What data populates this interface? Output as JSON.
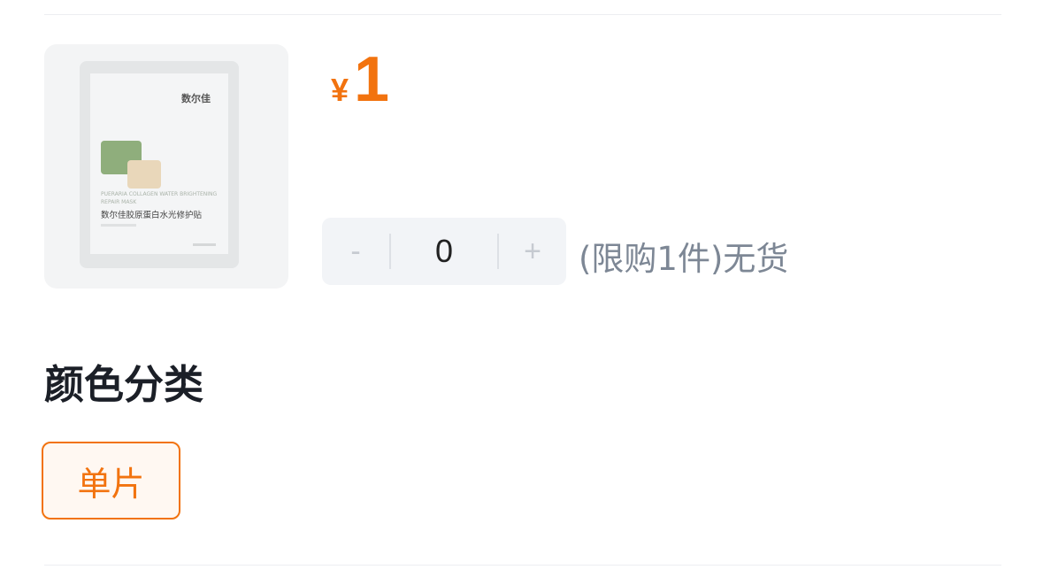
{
  "product": {
    "image": {
      "brand": "数尔佳",
      "latin_name": "PUERARIA COLLAGEN WATER BRIGHTENING REPAIR MASK",
      "cn_name": "数尔佳胶原蛋白水光修护贴"
    },
    "price": {
      "currency": "¥",
      "amount": "1"
    }
  },
  "quantity": {
    "decrement_label": "-",
    "value": "0",
    "increment_label": "+",
    "limit_text": "(限购1件)无货"
  },
  "variant": {
    "section_title": "颜色分类",
    "options": [
      {
        "label": "单片",
        "selected": true
      }
    ]
  },
  "colors": {
    "accent": "#f2730f",
    "muted_text": "#7d8795",
    "stepper_bg": "#f2f4f7"
  }
}
